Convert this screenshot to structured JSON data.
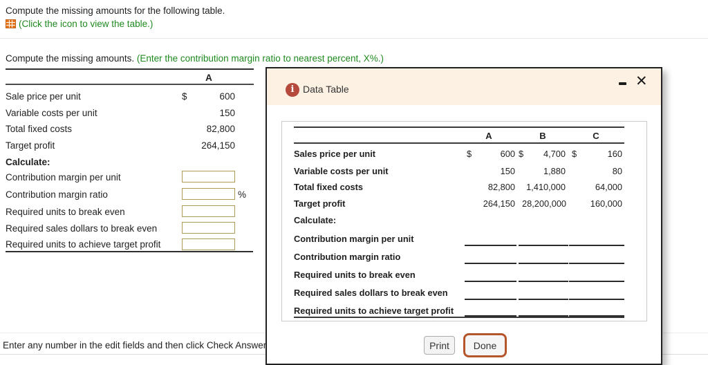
{
  "page": {
    "title": "Compute the missing amounts for the following table.",
    "icon_caption": "(Click the icon to view the table.)",
    "instruction": "Compute the missing amounts. ",
    "instruction_note": "(Enter the contribution margin ratio to nearest percent, X%.)",
    "footer_hint": "Enter any number in the edit fields and then click Check Answer"
  },
  "icons": {
    "table": "table-grid-icon",
    "info": "info-circle-icon",
    "minimize": "minus-icon",
    "close": "x-icon"
  },
  "left_table": {
    "column_header": "A",
    "rows": [
      {
        "label": "Sale price per unit",
        "cur": "$",
        "value": "600"
      },
      {
        "label": "Variable costs per unit",
        "cur": "",
        "value": "150"
      },
      {
        "label": "Total fixed costs",
        "cur": "",
        "value": "82,800"
      },
      {
        "label": "Target profit",
        "cur": "",
        "value": "264,150"
      }
    ],
    "calculate_label": "Calculate:",
    "answer_rows": [
      {
        "label": "Contribution margin per unit",
        "value": "",
        "suffix": ""
      },
      {
        "label": "Contribution margin ratio",
        "value": "",
        "suffix": "%"
      },
      {
        "label": "Required units to break even",
        "value": "",
        "suffix": ""
      },
      {
        "label": "Required sales dollars to break even",
        "value": "",
        "suffix": ""
      },
      {
        "label": "Required units to achieve target profit",
        "value": "",
        "suffix": ""
      }
    ]
  },
  "modal": {
    "title": "Data Table",
    "info_glyph": "i",
    "close_glyph": "✕",
    "table": {
      "column_headers": [
        "A",
        "B",
        "C"
      ],
      "rows": [
        {
          "label": "Sales price per unit",
          "c1": "$",
          "v1": "600",
          "c2": "$",
          "v2": "4,700",
          "c3": "$",
          "v3": "160"
        },
        {
          "label": "Variable costs per unit",
          "c1": "",
          "v1": "150",
          "c2": "",
          "v2": "1,880",
          "c3": "",
          "v3": "80"
        },
        {
          "label": "Total fixed costs",
          "c1": "",
          "v1": "82,800",
          "c2": "",
          "v2": "1,410,000",
          "c3": "",
          "v3": "64,000"
        },
        {
          "label": "Target profit",
          "c1": "",
          "v1": "264,150",
          "c2": "",
          "v2": "28,200,000",
          "c3": "",
          "v3": "160,000"
        }
      ],
      "calculate_label": "Calculate:",
      "blank_rows": [
        {
          "label": "Contribution margin per unit"
        },
        {
          "label": "Contribution margin ratio"
        },
        {
          "label": "Required units to break even"
        },
        {
          "label": "Required sales dollars to break even"
        },
        {
          "label": "Required units to achieve target profit"
        }
      ]
    },
    "buttons": {
      "print": "Print",
      "done": "Done"
    }
  },
  "colors": {
    "green_text": "#1e8a1e",
    "table_icon_orange": "#e87722",
    "info_icon_red": "#b5493b",
    "modal_header_bg": "#fcf1e3",
    "answer_box_border": "#b09a52",
    "done_button_border": "#b4552a"
  }
}
